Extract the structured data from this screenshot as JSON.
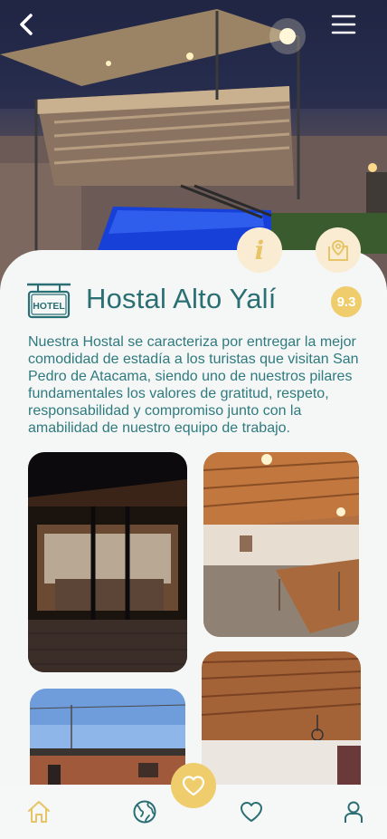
{
  "header": {
    "back_icon": "chevron-left-icon",
    "menu_icon": "hamburger-menu-icon"
  },
  "hotel": {
    "badge_icon": "hotel-sign-icon",
    "badge_text": "HOTEL",
    "name": "Hostal Alto Yalí",
    "rating": "9.3",
    "description": "Nuestra Hostal se caracteriza por entregar la mejor comodidad de estadía a los turistas que visitan San Pedro de Atacama, siendo uno de nuestros pilares fundamentales los valores de gratitud, respeto, responsabilidad y compromiso junto con la amabilidad de nuestro equipo de trabajo."
  },
  "actions": {
    "info_icon": "info-icon",
    "info_glyph": "i",
    "map_icon": "map-pin-icon"
  },
  "gallery": [
    {
      "subject": "night-dining-room-through-glass"
    },
    {
      "subject": "wood-ceiling-dining-room"
    },
    {
      "subject": "exterior-blue-sky"
    },
    {
      "subject": "wood-ceiling-room"
    }
  ],
  "bottom_nav": {
    "items": [
      {
        "icon": "home-icon",
        "active": true
      },
      {
        "icon": "globe-icon",
        "active": false
      },
      {
        "icon": "heart-icon",
        "active": false
      },
      {
        "icon": "user-icon",
        "active": false
      }
    ],
    "fab_icon": "heart-icon"
  },
  "colors": {
    "accent": "#efcd6c",
    "accent_soft": "#f9ecd2",
    "teal": "#2a6f73",
    "text_teal": "#2e7a7e"
  }
}
